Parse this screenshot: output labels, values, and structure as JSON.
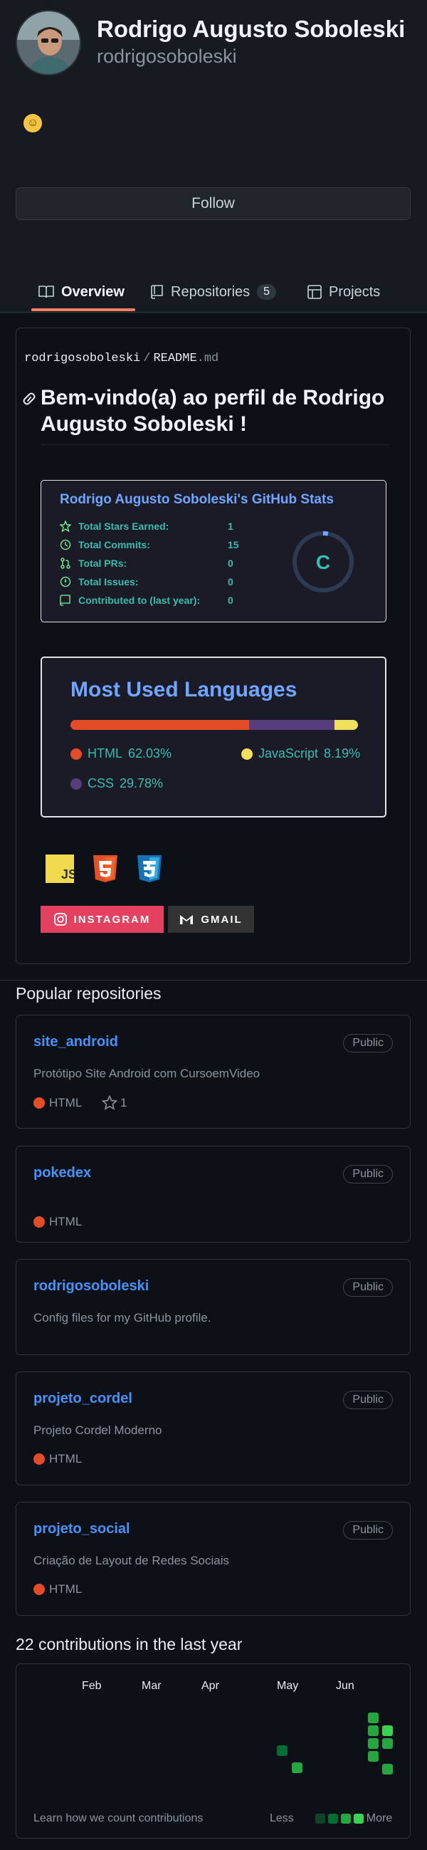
{
  "profile": {
    "name": "Rodrigo Augusto Soboleski",
    "login": "rodrigosoboleski",
    "status_emoji": "☺",
    "follow_label": "Follow"
  },
  "tabs": [
    {
      "label": "Overview",
      "icon": "book-icon",
      "active": true
    },
    {
      "label": "Repositories",
      "icon": "repo-icon",
      "count": "5"
    },
    {
      "label": "Projects",
      "icon": "table-icon"
    }
  ],
  "readme": {
    "owner": "rodrigosoboleski",
    "separator": "/",
    "file": "README",
    "ext": ".md",
    "title": "Bem-vindo(a) ao perfil de Rodrigo Augusto Soboleski !"
  },
  "stats_card": {
    "title": "Rodrigo Augusto Soboleski's GitHub Stats",
    "rows": [
      {
        "label": "Total Stars Earned:",
        "value": "1",
        "icon": "star-icon"
      },
      {
        "label": "Total Commits:",
        "value": "15",
        "icon": "history-icon"
      },
      {
        "label": "Total PRs:",
        "value": "0",
        "icon": "pull-request-icon"
      },
      {
        "label": "Total Issues:",
        "value": "0",
        "icon": "issue-icon"
      },
      {
        "label": "Contributed to (last year):",
        "value": "0",
        "icon": "repo-icon"
      }
    ],
    "grade": "C",
    "colors": {
      "title": "#70a5fd",
      "text": "#38bdae",
      "bg": "#1a1b27"
    }
  },
  "languages_card": {
    "title": "Most Used Languages",
    "languages": [
      {
        "name": "HTML",
        "percent": "62.03%",
        "value": 62.03,
        "color": "#e34c26"
      },
      {
        "name": "CSS",
        "percent": "29.78%",
        "value": 29.78,
        "color": "#563d7c"
      },
      {
        "name": "JavaScript",
        "percent": "8.19%",
        "value": 8.19,
        "color": "#f1e05a"
      }
    ]
  },
  "badges": {
    "tech": [
      "javascript-logo",
      "html5-logo",
      "css3-logo"
    ],
    "js_text": "JS",
    "instagram": {
      "label": "INSTAGRAM",
      "color": "#e4405f"
    },
    "gmail": {
      "label": "GMAIL",
      "color": "#333333"
    }
  },
  "popular": {
    "heading": "Popular repositories",
    "repos": [
      {
        "name": "site_android",
        "visibility": "Public",
        "description": "Protótipo Site Android com CursoemVideo",
        "language": "HTML",
        "stars": "1"
      },
      {
        "name": "pokedex",
        "visibility": "Public",
        "description": "",
        "language": "HTML"
      },
      {
        "name": "rodrigosoboleski",
        "visibility": "Public",
        "description": "Config files for my GitHub profile.",
        "language": ""
      },
      {
        "name": "projeto_cordel",
        "visibility": "Public",
        "description": "Projeto Cordel Moderno",
        "language": "HTML"
      },
      {
        "name": "projeto_social",
        "visibility": "Public",
        "description": "Criação de Layout de Redes Sociais",
        "language": "HTML"
      }
    ],
    "lang_color": "#e34c26"
  },
  "contributions": {
    "heading": "22 contributions in the last year",
    "months": [
      "Feb",
      "Mar",
      "Apr",
      "May",
      "Jun"
    ],
    "learn": "Learn how we count contributions",
    "less": "Less",
    "more": "More",
    "levels": [
      "#0e4429",
      "#006d32",
      "#26a641",
      "#39d353"
    ]
  }
}
